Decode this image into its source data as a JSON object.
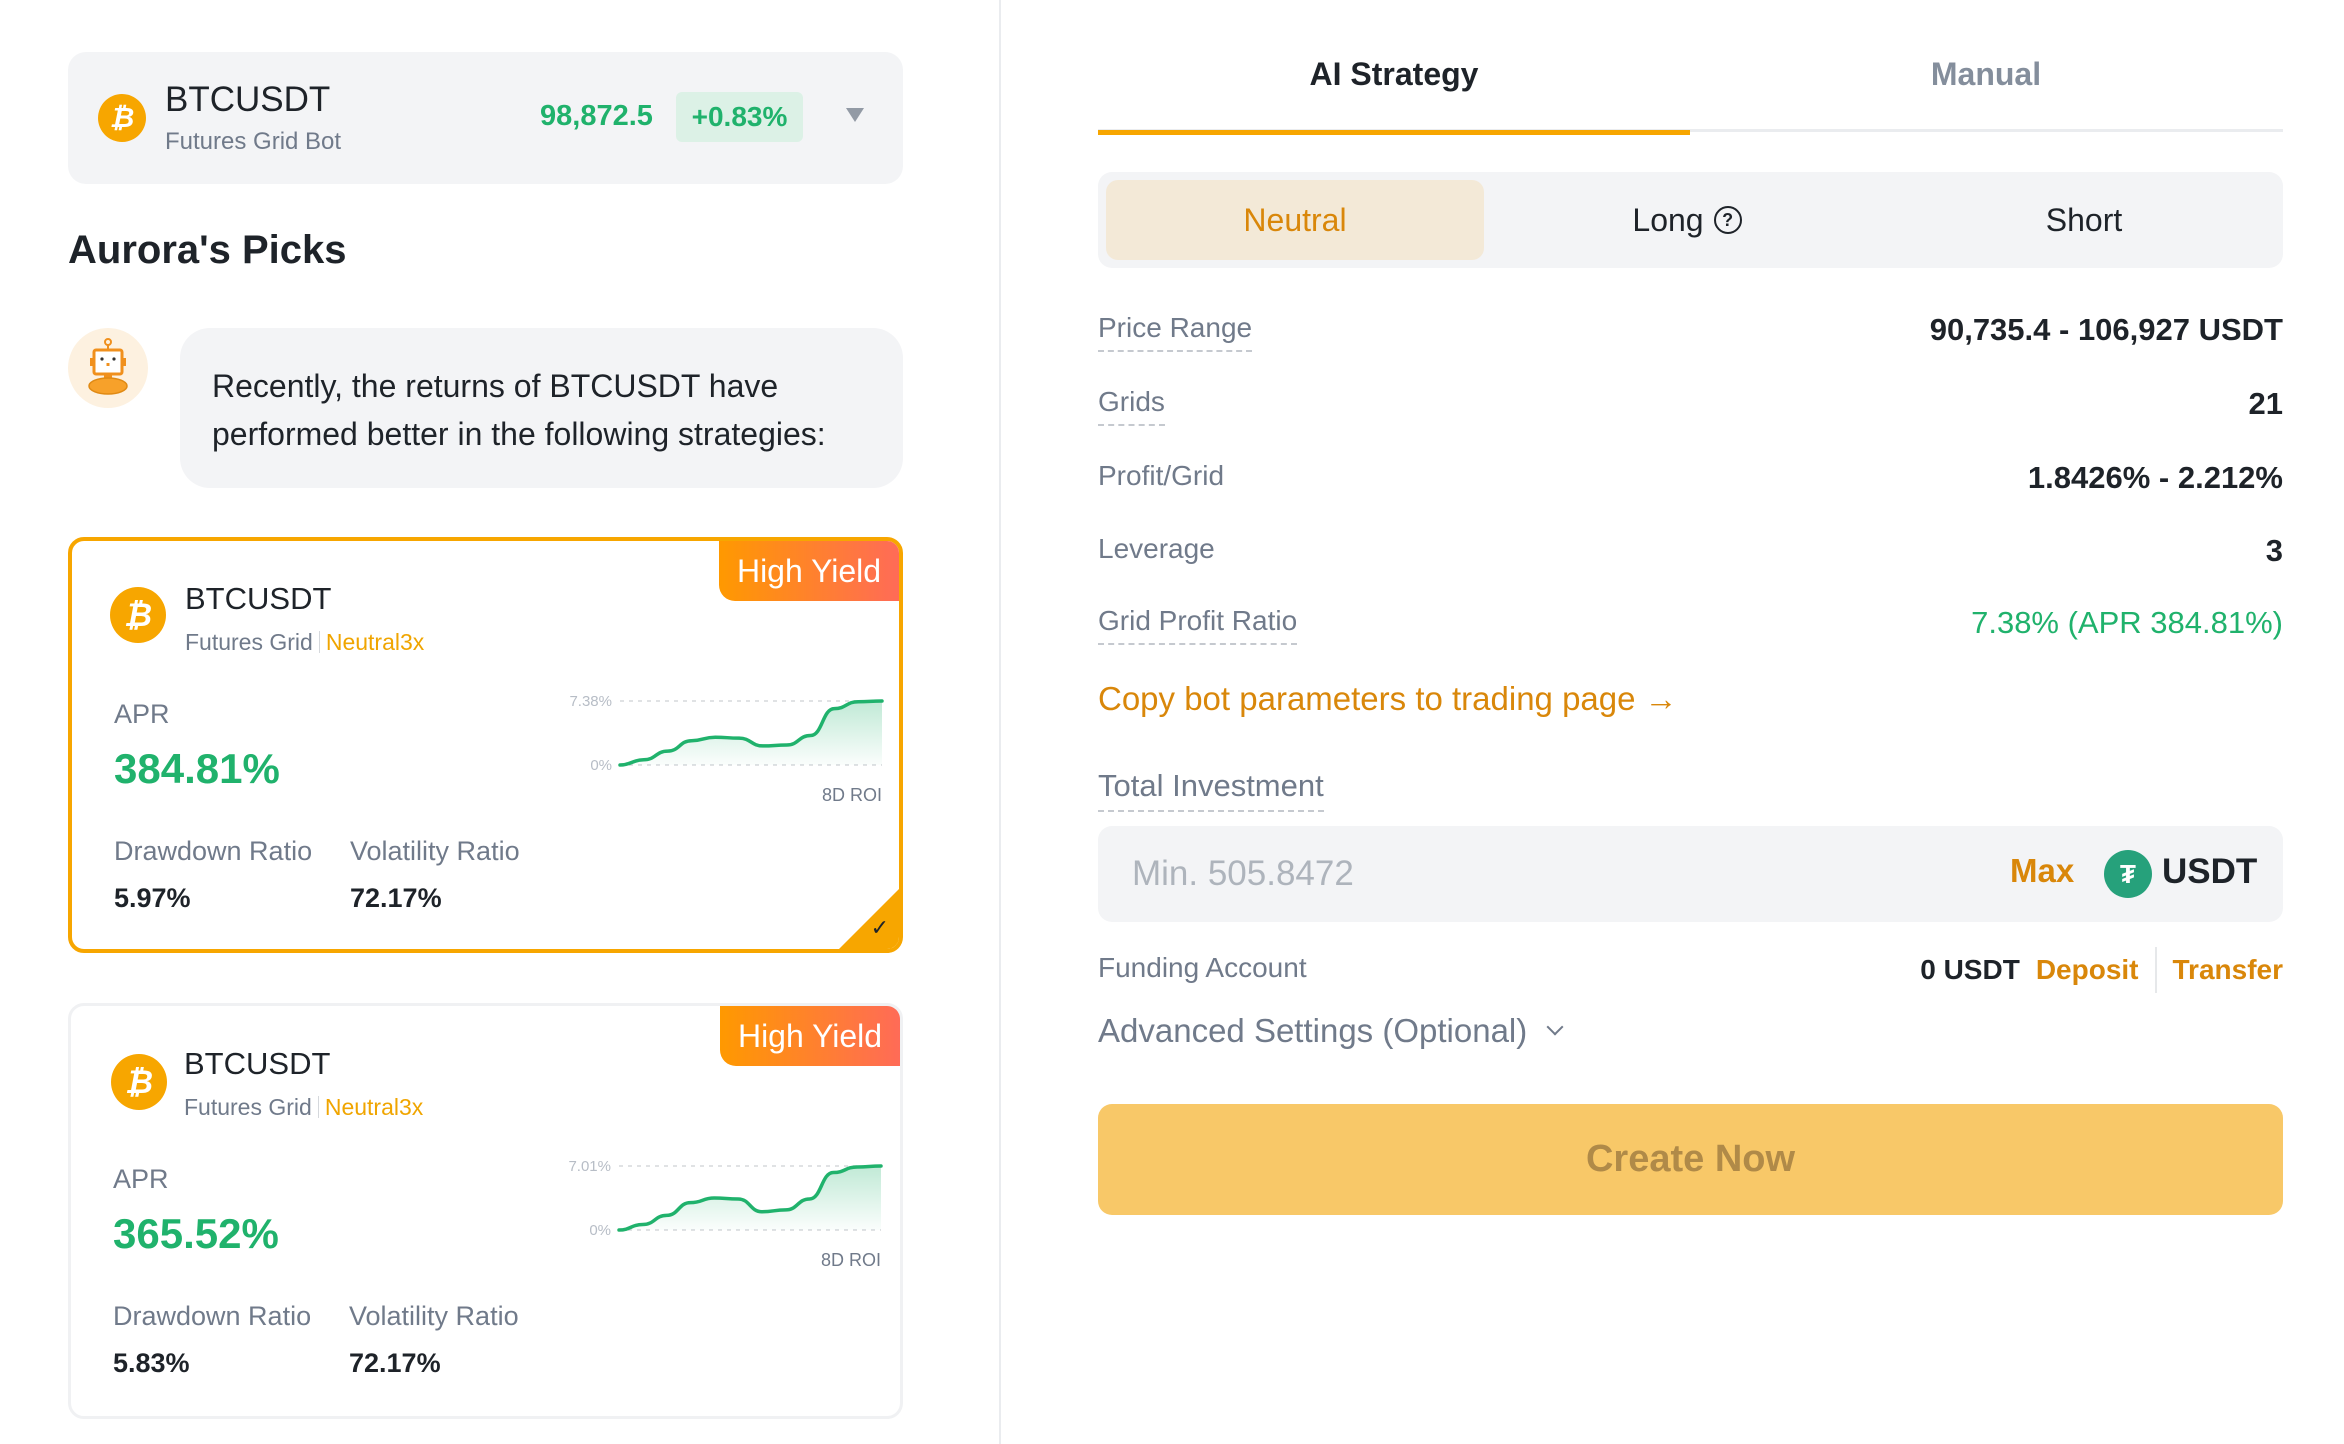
{
  "pair_selector": {
    "symbol": "BTCUSDT",
    "subtitle": "Futures Grid Bot",
    "price": "98,872.5",
    "change": "+0.83%",
    "coin_icon": "₿"
  },
  "picks": {
    "title": "Aurora's Picks",
    "message_line1": "Recently, the returns of BTCUSDT have",
    "message_line2": "performed better in the following strategies:"
  },
  "strategy_cards": [
    {
      "badge": "High Yield",
      "symbol": "BTCUSDT",
      "type": "Futures Grid",
      "mode": "Neutral3x",
      "apr_label": "APR",
      "apr": "384.81%",
      "drawdown_label": "Drawdown Ratio",
      "drawdown": "5.97%",
      "volatility_label": "Volatility Ratio",
      "volatility": "72.17%",
      "selected": true,
      "chart_data": {
        "type": "area",
        "title": "8D ROI",
        "ylabel_top": "7.38%",
        "ylabel_bottom": "0%",
        "ylim": [
          0,
          7.38
        ],
        "values": [
          0,
          0.6,
          1.6,
          2.8,
          3.2,
          3.1,
          2.2,
          2.3,
          3.4,
          6.5,
          7.3,
          7.38
        ]
      }
    },
    {
      "badge": "High Yield",
      "symbol": "BTCUSDT",
      "type": "Futures Grid",
      "mode": "Neutral3x",
      "apr_label": "APR",
      "apr": "365.52%",
      "drawdown_label": "Drawdown Ratio",
      "drawdown": "5.83%",
      "volatility_label": "Volatility Ratio",
      "volatility": "72.17%",
      "selected": false,
      "chart_data": {
        "type": "area",
        "title": "8D ROI",
        "ylabel_top": "7.01%",
        "ylabel_bottom": "0%",
        "ylim": [
          0,
          7.01
        ],
        "values": [
          0,
          0.6,
          1.6,
          3.0,
          3.5,
          3.4,
          2.0,
          2.2,
          3.4,
          6.3,
          6.9,
          7.01
        ]
      }
    }
  ],
  "tabs": {
    "ai": "AI Strategy",
    "manual": "Manual",
    "active": "AI Strategy"
  },
  "direction": {
    "neutral": "Neutral",
    "long": "Long",
    "short": "Short",
    "active": "Neutral"
  },
  "params": [
    {
      "label": "Price Range",
      "value": "90,735.4 - 106,927 USDT"
    },
    {
      "label": "Grids",
      "value": "21"
    },
    {
      "label": "Profit/Grid",
      "value": "1.8426% - 2.212%"
    },
    {
      "label": "Leverage",
      "value": "3"
    },
    {
      "label": "Grid Profit Ratio",
      "value": "7.38% (APR 384.81%)"
    }
  ],
  "copy_link": "Copy bot parameters to trading page →",
  "investment": {
    "label": "Total Investment",
    "placeholder": "Min. 505.8472",
    "value": "",
    "max": "Max",
    "currency": "USDT"
  },
  "funding": {
    "label": "Funding Account",
    "balance": "0 USDT",
    "deposit": "Deposit",
    "transfer": "Transfer"
  },
  "advanced": "Advanced Settings (Optional)",
  "create_button": "Create Now",
  "colors": {
    "accent": "#f7a600",
    "link": "#d9870a",
    "positive": "#20b26c",
    "button": "#f8c868"
  }
}
